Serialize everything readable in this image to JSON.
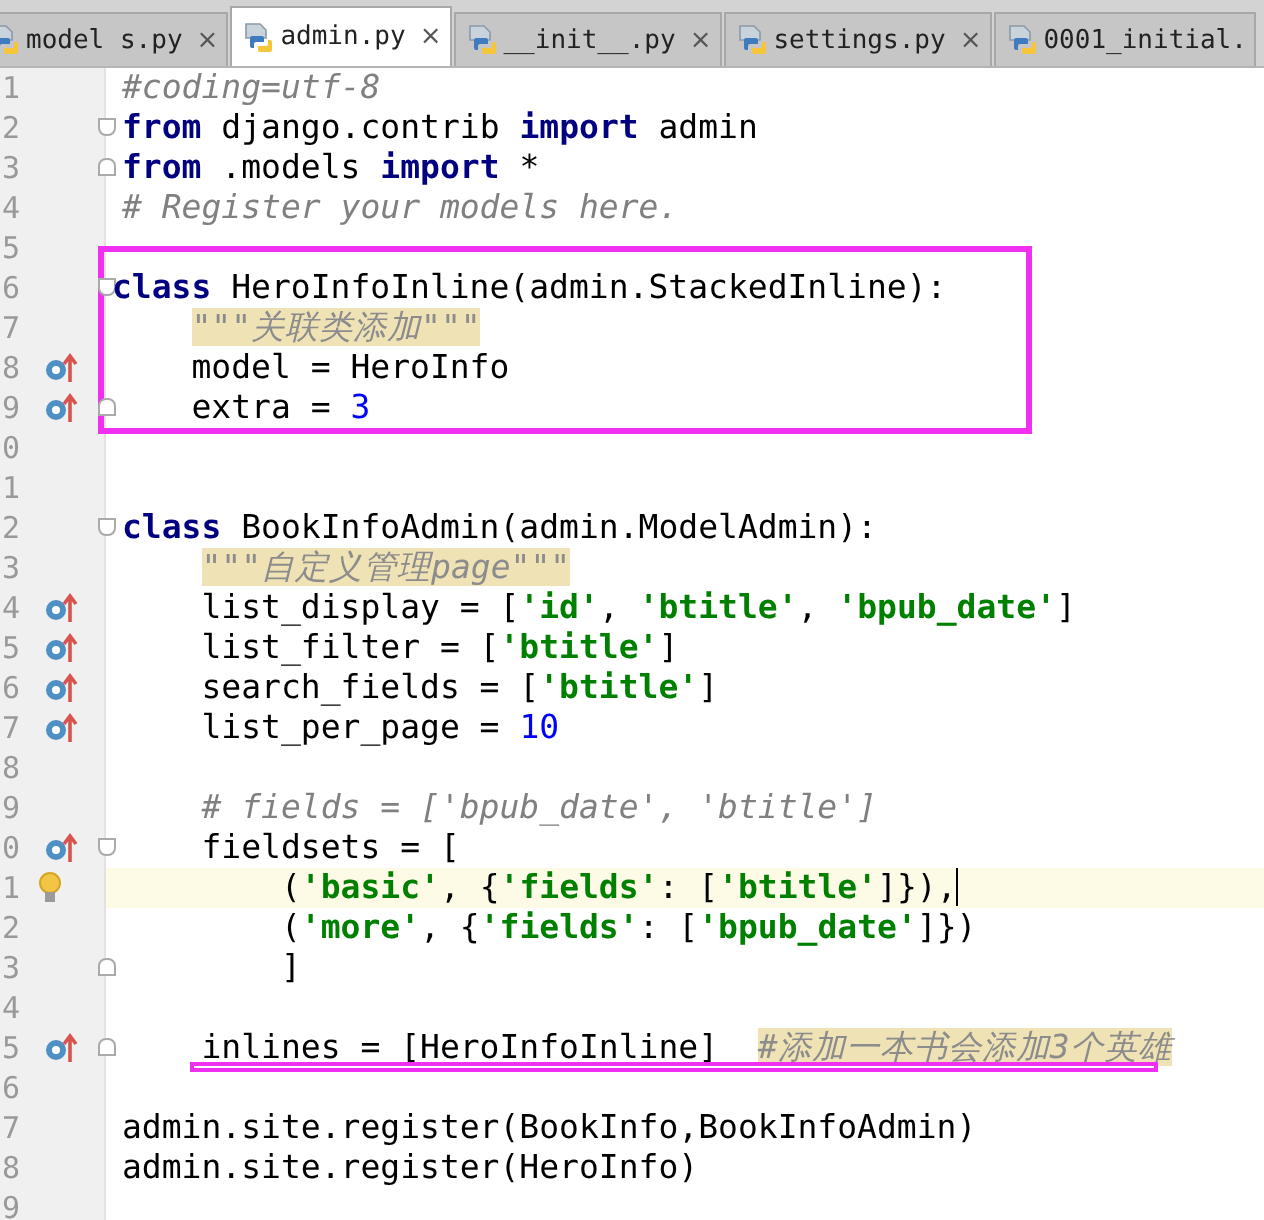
{
  "tabs": [
    {
      "label": "model s.py",
      "selected": false,
      "close": "×"
    },
    {
      "label": "admin.py",
      "selected": true,
      "close": "×"
    },
    {
      "label": "__init__.py",
      "selected": false,
      "close": "×"
    },
    {
      "label": "settings.py",
      "selected": false,
      "close": "×"
    },
    {
      "label": "0001_initial.",
      "selected": false
    }
  ],
  "editor": {
    "lines": [
      {
        "number": "1",
        "segments": [
          {
            "kind": "comment",
            "text": "#coding=utf-8"
          }
        ]
      },
      {
        "number": "2",
        "fold_open": true,
        "segments": [
          {
            "kind": "keyword",
            "text": "from"
          },
          {
            "kind": "plain",
            "text": " django.contrib "
          },
          {
            "kind": "keyword",
            "text": "import"
          },
          {
            "kind": "plain",
            "text": " admin"
          }
        ]
      },
      {
        "number": "3",
        "fold_close": true,
        "segments": [
          {
            "kind": "keyword",
            "text": "from"
          },
          {
            "kind": "plain",
            "text": " .models "
          },
          {
            "kind": "keyword",
            "text": "import"
          },
          {
            "kind": "plain",
            "text": " *"
          }
        ]
      },
      {
        "number": "4",
        "segments": [
          {
            "kind": "comment",
            "text": "# Register your models here."
          }
        ]
      },
      {
        "number": "5"
      },
      {
        "number": "6",
        "fold_open": true,
        "framed": true,
        "segments": [
          {
            "kind": "keyword",
            "text": "class"
          },
          {
            "kind": "plain",
            "text": " HeroInfoInline(admin.StackedInline):"
          }
        ]
      },
      {
        "number": "7",
        "framed": true,
        "segments": [
          {
            "kind": "doc",
            "text": "    \"\"\"关联类添加\"\"\""
          }
        ]
      },
      {
        "number": "8",
        "marker": true,
        "framed": true,
        "segments": [
          {
            "kind": "plain",
            "text": "    model = HeroInfo"
          }
        ]
      },
      {
        "number": "9",
        "marker": true,
        "fold_close": true,
        "framed": true,
        "segments": [
          {
            "kind": "plain",
            "text": "    extra = "
          },
          {
            "kind": "number",
            "text": "3"
          }
        ]
      },
      {
        "number": "0"
      },
      {
        "number": "1"
      },
      {
        "number": "2",
        "fold_open": true,
        "segments": [
          {
            "kind": "keyword",
            "text": "class"
          },
          {
            "kind": "plain",
            "text": " BookInfoAdmin(admin.ModelAdmin):"
          }
        ]
      },
      {
        "number": "3",
        "segments": [
          {
            "kind": "doc",
            "text": "    \"\"\"自定义管理page\"\"\""
          }
        ]
      },
      {
        "number": "4",
        "marker": true,
        "segments": [
          {
            "kind": "plain",
            "text": "    list_display = ["
          },
          {
            "kind": "string",
            "text": "'id'"
          },
          {
            "kind": "plain",
            "text": ", "
          },
          {
            "kind": "string",
            "text": "'btitle'"
          },
          {
            "kind": "plain",
            "text": ", "
          },
          {
            "kind": "string",
            "text": "'bpub_date'"
          },
          {
            "kind": "plain",
            "text": "]"
          }
        ]
      },
      {
        "number": "5",
        "marker": true,
        "segments": [
          {
            "kind": "plain",
            "text": "    list_filter = ["
          },
          {
            "kind": "string",
            "text": "'btitle'"
          },
          {
            "kind": "plain",
            "text": "]"
          }
        ]
      },
      {
        "number": "6",
        "marker": true,
        "segments": [
          {
            "kind": "plain",
            "text": "    search_fields = ["
          },
          {
            "kind": "string",
            "text": "'btitle'"
          },
          {
            "kind": "plain",
            "text": "]"
          }
        ]
      },
      {
        "number": "7",
        "marker": true,
        "segments": [
          {
            "kind": "plain",
            "text": "    list_per_page = "
          },
          {
            "kind": "number",
            "text": "10"
          }
        ]
      },
      {
        "number": "8"
      },
      {
        "number": "9",
        "segments": [
          {
            "kind": "comment",
            "text": "    # fields = ['bpub_date', 'btitle']"
          }
        ]
      },
      {
        "number": "0",
        "marker": true,
        "fold_open": true,
        "segments": [
          {
            "kind": "plain",
            "text": "    fieldsets = ["
          }
        ]
      },
      {
        "number": "1",
        "current": true,
        "bulb": true,
        "segments": [
          {
            "kind": "plain",
            "text": "        ("
          },
          {
            "kind": "string",
            "text": "'basic'"
          },
          {
            "kind": "plain",
            "text": ", {"
          },
          {
            "kind": "string",
            "text": "'fields'"
          },
          {
            "kind": "plain",
            "text": ": ["
          },
          {
            "kind": "string",
            "text": "'btitle'"
          },
          {
            "kind": "plain",
            "text": "]}),"
          }
        ]
      },
      {
        "number": "2",
        "segments": [
          {
            "kind": "plain",
            "text": "        ("
          },
          {
            "kind": "string",
            "text": "'more'"
          },
          {
            "kind": "plain",
            "text": ", {"
          },
          {
            "kind": "string",
            "text": "'fields'"
          },
          {
            "kind": "plain",
            "text": ": ["
          },
          {
            "kind": "string",
            "text": "'bpub_date'"
          },
          {
            "kind": "plain",
            "text": "]})"
          }
        ]
      },
      {
        "number": "3",
        "fold_close": true,
        "segments": [
          {
            "kind": "plain",
            "text": "        ]"
          }
        ]
      },
      {
        "number": "4"
      },
      {
        "number": "5",
        "marker": true,
        "fold_close": true,
        "underlined": true,
        "segments": [
          {
            "kind": "plain",
            "text": "    inlines = [HeroInfoInline]  "
          },
          {
            "kind": "doc",
            "text": "#添加一本书会添加3个英雄"
          }
        ]
      },
      {
        "number": "6"
      },
      {
        "number": "7",
        "segments": [
          {
            "kind": "plain",
            "text": "admin.site.register(BookInfo,BookInfoAdmin)"
          }
        ]
      },
      {
        "number": "8",
        "segments": [
          {
            "kind": "plain",
            "text": "admin.site.register(HeroInfo)"
          }
        ]
      },
      {
        "number": "9"
      }
    ]
  }
}
